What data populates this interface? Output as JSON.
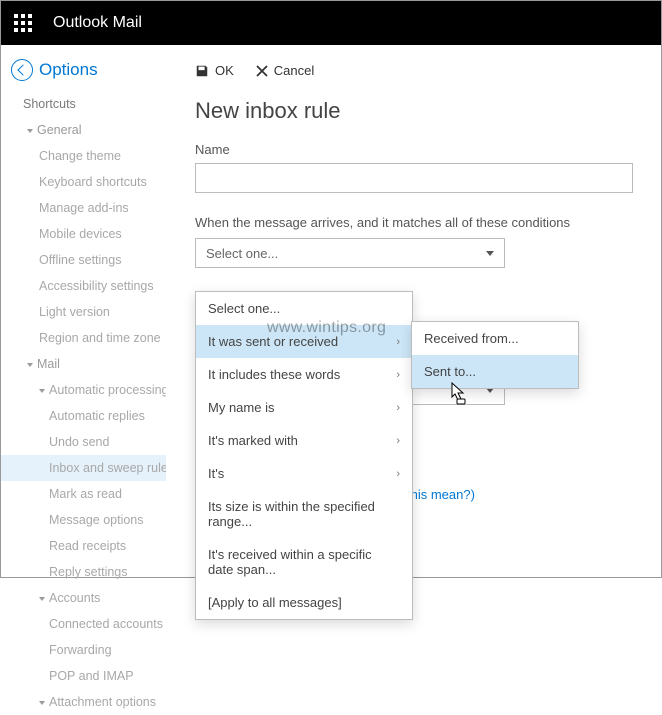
{
  "header": {
    "app_title": "Outlook Mail"
  },
  "sidebar": {
    "back_label": "Options",
    "items": [
      {
        "label": "Shortcuts",
        "lvl": 0,
        "caret": false
      },
      {
        "label": "General",
        "lvl": 1,
        "caret": true
      },
      {
        "label": "Change theme",
        "lvl": 2
      },
      {
        "label": "Keyboard shortcuts",
        "lvl": 2
      },
      {
        "label": "Manage add-ins",
        "lvl": 2
      },
      {
        "label": "Mobile devices",
        "lvl": 2
      },
      {
        "label": "Offline settings",
        "lvl": 2
      },
      {
        "label": "Accessibility settings",
        "lvl": 2
      },
      {
        "label": "Light version",
        "lvl": 2
      },
      {
        "label": "Region and time zone",
        "lvl": 2
      },
      {
        "label": "Mail",
        "lvl": 1,
        "caret": true
      },
      {
        "label": "Automatic processing",
        "lvl": 2,
        "caret": true
      },
      {
        "label": "Automatic replies",
        "lvl": 3
      },
      {
        "label": "Undo send",
        "lvl": 3
      },
      {
        "label": "Inbox and sweep rules",
        "lvl": 3,
        "active": true
      },
      {
        "label": "Mark as read",
        "lvl": 3
      },
      {
        "label": "Message options",
        "lvl": 3
      },
      {
        "label": "Read receipts",
        "lvl": 3
      },
      {
        "label": "Reply settings",
        "lvl": 3
      },
      {
        "label": "Accounts",
        "lvl": 2,
        "caret": true
      },
      {
        "label": "Connected accounts",
        "lvl": 3
      },
      {
        "label": "Forwarding",
        "lvl": 3
      },
      {
        "label": "POP and IMAP",
        "lvl": 3
      },
      {
        "label": "Attachment options",
        "lvl": 2,
        "caret": true
      }
    ]
  },
  "toolbar": {
    "ok": "OK",
    "cancel": "Cancel"
  },
  "page": {
    "title": "New inbox rule",
    "name_label": "Name",
    "name_value": "",
    "cond_label": "When the message arrives, and it matches all of these conditions",
    "select_placeholder": "Select one..."
  },
  "dropdown1": {
    "items": [
      {
        "label": "Select one...",
        "arrow": false
      },
      {
        "label": "It was sent or received",
        "arrow": true,
        "hover": true
      },
      {
        "label": "It includes these words",
        "arrow": true
      },
      {
        "label": "My name is",
        "arrow": true
      },
      {
        "label": "It's marked with",
        "arrow": true
      },
      {
        "label": "It's",
        "arrow": true
      },
      {
        "label": "Its size is within the specified range...",
        "arrow": false
      },
      {
        "label": "It's received within a specific date span...",
        "arrow": false
      },
      {
        "label": "[Apply to all messages]",
        "arrow": false
      }
    ]
  },
  "dropdown2": {
    "items": [
      {
        "label": "Received from...",
        "hover": false
      },
      {
        "label": "Sent to...",
        "hover": true
      }
    ]
  },
  "bottom_link": "this mean?)",
  "watermark": "www.wintips.org"
}
